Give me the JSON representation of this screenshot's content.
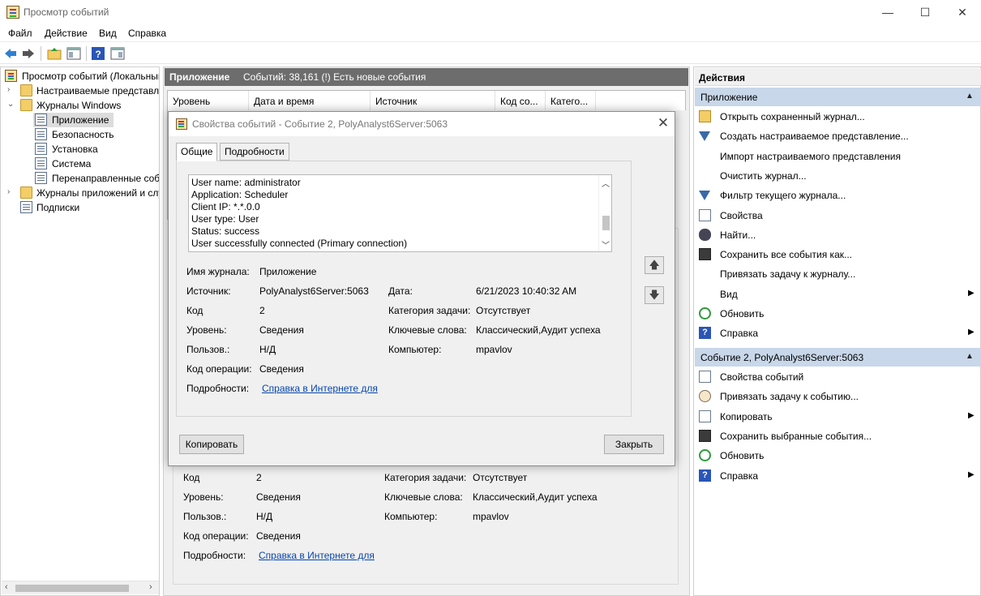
{
  "window": {
    "title": "Просмотр событий",
    "controls": {
      "minimize": "—",
      "maximize": "☐",
      "close": "✕"
    }
  },
  "menu": [
    "Файл",
    "Действие",
    "Вид",
    "Справка"
  ],
  "toolbar": [
    "back-icon",
    "forward-icon",
    "folder-up-icon",
    "console-tree-icon",
    "help-icon",
    "action-pane-icon"
  ],
  "tree": {
    "root": "Просмотр событий (Локальный)",
    "custom_views": "Настраиваемые представления",
    "windows_logs": "Журналы Windows",
    "application": "Приложение",
    "security": "Безопасность",
    "setup": "Установка",
    "system": "Система",
    "forwarded": "Перенаправленные события",
    "app_service_logs": "Журналы приложений и служб",
    "subscriptions": "Подписки"
  },
  "center": {
    "title": "Приложение",
    "count": "Событий: 38,161 (!) Есть новые события",
    "columns": [
      "Уровень",
      "Дата и время",
      "Источник",
      "Код со...",
      "Катего..."
    ]
  },
  "background_detail": {
    "code_label": "Код",
    "code": "2",
    "task_cat_label": "Категория задачи:",
    "task_cat": "Отсутствует",
    "level_label": "Уровень:",
    "level": "Сведения",
    "keywords_label": "Ключевые слова:",
    "keywords": "Классический,Аудит успеха",
    "user_label": "Пользов.:",
    "user": "Н/Д",
    "computer_label": "Компьютер:",
    "computer": "mpavlov",
    "opcode_label": "Код операции:",
    "opcode": "Сведения",
    "details_label": "Подробности:",
    "details_link": "Справка в Интернете для"
  },
  "dialog": {
    "title": "Свойства событий - Событие 2, PolyAnalyst6Server:5063",
    "tabs": [
      "Общие",
      "Подробности"
    ],
    "description_lines": [
      "User name: administrator",
      "Application: Scheduler",
      "Client IP: *.*.0.0",
      "User type: User",
      "Status: success",
      "User successfully connected (Primary connection)"
    ],
    "log_name_label": "Имя журнала:",
    "log_name": "Приложение",
    "source_label": "Источник:",
    "source": "PolyAnalyst6Server:5063",
    "date_label": "Дата:",
    "date": "6/21/2023 10:40:32 AM",
    "code_label": "Код",
    "code": "2",
    "task_cat_label": "Категория задачи:",
    "task_cat": "Отсутствует",
    "level_label": "Уровень:",
    "level": "Сведения",
    "keywords_label": "Ключевые слова:",
    "keywords": "Классический,Аудит успеха",
    "user_label": "Пользов.:",
    "user": "Н/Д",
    "computer_label": "Компьютер:",
    "computer": "mpavlov",
    "opcode_label": "Код операции:",
    "opcode": "Сведения",
    "details_label": "Подробности:",
    "details_link": "Справка в Интернете для",
    "copy_button": "Копировать",
    "close_button": "Закрыть"
  },
  "actions": {
    "title": "Действия",
    "section1": "Приложение",
    "items1": [
      {
        "icon": "open-log-icon",
        "label": "Открыть сохраненный журнал..."
      },
      {
        "icon": "filter-icon",
        "label": "Создать настраиваемое представление..."
      },
      {
        "icon": "",
        "label": "Импорт настраиваемого представления"
      },
      {
        "icon": "",
        "label": "Очистить журнал..."
      },
      {
        "icon": "filter-icon",
        "label": "Фильтр текущего журнала..."
      },
      {
        "icon": "properties-icon",
        "label": "Свойства"
      },
      {
        "icon": "find-icon",
        "label": "Найти..."
      },
      {
        "icon": "save-icon",
        "label": "Сохранить все события как..."
      },
      {
        "icon": "",
        "label": "Привязать задачу к журналу..."
      },
      {
        "icon": "",
        "label": "Вид"
      },
      {
        "icon": "refresh-icon",
        "label": "Обновить"
      },
      {
        "icon": "help-icon",
        "label": "Справка"
      }
    ],
    "section2": "Событие 2, PolyAnalyst6Server:5063",
    "items2": [
      {
        "icon": "event-properties-icon",
        "label": "Свойства событий"
      },
      {
        "icon": "attach-task-icon",
        "label": "Привязать задачу к событию..."
      },
      {
        "icon": "copy-icon",
        "label": "Копировать"
      },
      {
        "icon": "save-icon",
        "label": "Сохранить выбранные события..."
      },
      {
        "icon": "refresh-icon",
        "label": "Обновить"
      },
      {
        "icon": "help-icon",
        "label": "Справка"
      }
    ]
  }
}
